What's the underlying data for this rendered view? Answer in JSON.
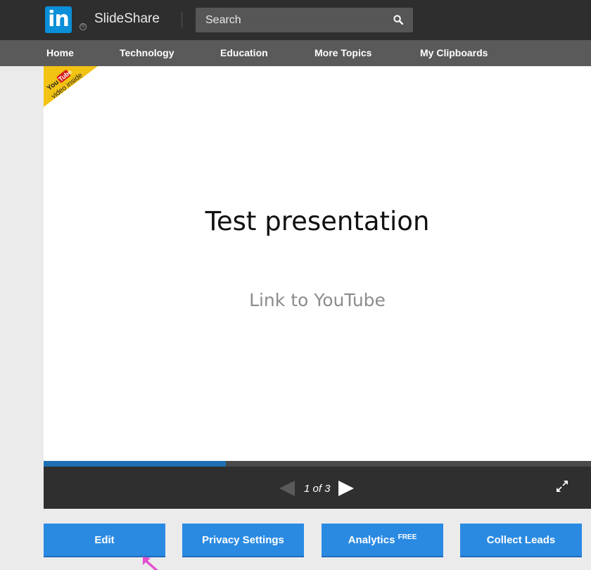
{
  "header": {
    "logo_in": "in",
    "logo_reg": "®",
    "brand": "SlideShare",
    "search_placeholder": "Search",
    "icons": {
      "search": "search-icon"
    }
  },
  "nav": {
    "items": [
      {
        "label": "Home"
      },
      {
        "label": "Technology"
      },
      {
        "label": "Education"
      },
      {
        "label": "More Topics"
      },
      {
        "label": "My Clipboards"
      }
    ]
  },
  "slide": {
    "badge": {
      "line1": "You",
      "line1_suffix": "Tube",
      "line2": "video inside"
    },
    "title": "Test presentation",
    "subtitle": "Link to YouTube"
  },
  "player": {
    "progress": 0.333,
    "page_indicator": "1 of 3",
    "colors": {
      "progress": "#1f6fb5",
      "controls_bg": "#2f2f2f"
    }
  },
  "actions": {
    "edit": "Edit",
    "privacy": "Privacy Settings",
    "analytics": "Analytics",
    "analytics_badge": "FREE",
    "collect": "Collect Leads",
    "color": "#2a8ae2"
  }
}
